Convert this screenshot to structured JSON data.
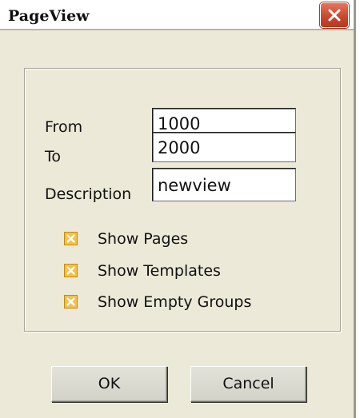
{
  "window": {
    "title": "PageView",
    "close_icon": "close-icon"
  },
  "form": {
    "from": {
      "label": "From",
      "value": "1000"
    },
    "to": {
      "label": "To",
      "value": "2000"
    },
    "description": {
      "label": "Description",
      "value": "newview"
    }
  },
  "options": [
    {
      "label": "Show Pages",
      "checked": true
    },
    {
      "label": "Show Templates",
      "checked": true
    },
    {
      "label": "Show Empty Groups",
      "checked": true
    }
  ],
  "buttons": {
    "ok_label": "OK",
    "cancel_label": "Cancel"
  },
  "colors": {
    "window_bg": "#ece9d8",
    "close_button": "#c9452a",
    "checkbox_fill": "#f4c04a"
  }
}
